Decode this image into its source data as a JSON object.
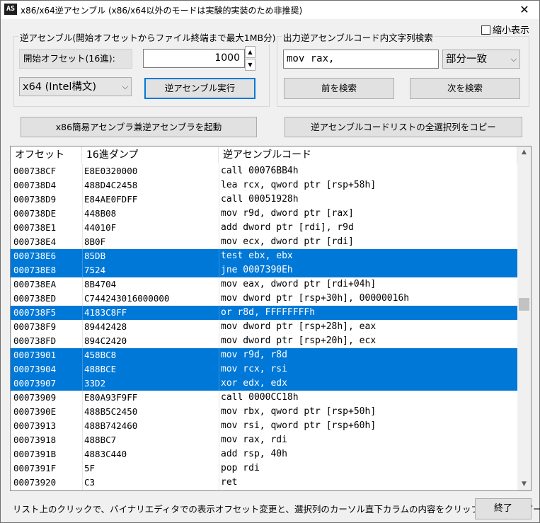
{
  "window": {
    "title": "x86/x64逆アセンブル (x86/x64以外のモードは実験的実装のため非推奨)",
    "icon_text": "AS",
    "close_glyph": "✕"
  },
  "options": {
    "shrink_label": "縮小表示",
    "shrink_checked": false
  },
  "disasm_group": {
    "legend": "逆アセンブル(開始オフセットからファイル終端まで最大1MB分)",
    "offset_label": "開始オフセット(16進):",
    "offset_value": "1000",
    "spin_up": "▲",
    "spin_down": "▼",
    "mode_value": "x64 (Intel構文)",
    "run_button": "逆アセンブル実行"
  },
  "search_group": {
    "legend": "出力逆アセンブルコード内文字列検索",
    "query": "mov rax,",
    "match_mode": "部分一致",
    "prev_button": "前を検索",
    "next_button": "次を検索"
  },
  "actions": {
    "launch_assembler": "x86簡易アセンブラ兼逆アセンブラを起動",
    "copy_column": "逆アセンブルコードリストの全選択列をコピー"
  },
  "list": {
    "columns": [
      "オフセット",
      "16進ダンプ",
      "逆アセンブルコード"
    ],
    "rows": [
      {
        "offset": "000738CF",
        "hex": "E8E0320000",
        "code": "call 00076BB4h",
        "selected": false
      },
      {
        "offset": "000738D4",
        "hex": "488D4C2458",
        "code": "lea rcx, qword ptr [rsp+58h]",
        "selected": false
      },
      {
        "offset": "000738D9",
        "hex": "E84AE0FDFF",
        "code": "call 00051928h",
        "selected": false
      },
      {
        "offset": "000738DE",
        "hex": "448B08",
        "code": "mov r9d, dword ptr [rax]",
        "selected": false
      },
      {
        "offset": "000738E1",
        "hex": "44010F",
        "code": "add dword ptr [rdi], r9d",
        "selected": false
      },
      {
        "offset": "000738E4",
        "hex": "8B0F",
        "code": "mov ecx, dword ptr [rdi]",
        "selected": false
      },
      {
        "offset": "000738E6",
        "hex": "85DB",
        "code": "test ebx, ebx",
        "selected": true
      },
      {
        "offset": "000738E8",
        "hex": "7524",
        "code": "jne 0007390Eh",
        "selected": true
      },
      {
        "offset": "000738EA",
        "hex": "8B4704",
        "code": "mov eax, dword ptr [rdi+04h]",
        "selected": false
      },
      {
        "offset": "000738ED",
        "hex": "C744243016000000",
        "code": "mov dword ptr [rsp+30h], 00000016h",
        "selected": false
      },
      {
        "offset": "000738F5",
        "hex": "4183C8FF",
        "code": "or r8d, FFFFFFFFh",
        "selected": true
      },
      {
        "offset": "000738F9",
        "hex": "89442428",
        "code": "mov dword ptr [rsp+28h], eax",
        "selected": false
      },
      {
        "offset": "000738FD",
        "hex": "894C2420",
        "code": "mov dword ptr [rsp+20h], ecx",
        "selected": false
      },
      {
        "offset": "00073901",
        "hex": "458BC8",
        "code": "mov r9d, r8d",
        "selected": true
      },
      {
        "offset": "00073904",
        "hex": "488BCE",
        "code": "mov rcx, rsi",
        "selected": true
      },
      {
        "offset": "00073907",
        "hex": "33D2",
        "code": "xor edx, edx",
        "selected": true
      },
      {
        "offset": "00073909",
        "hex": "E80A93F9FF",
        "code": "call 0000CC18h",
        "selected": false
      },
      {
        "offset": "0007390E",
        "hex": "488B5C2450",
        "code": "mov rbx, qword ptr [rsp+50h]",
        "selected": false
      },
      {
        "offset": "00073913",
        "hex": "488B742460",
        "code": "mov rsi, qword ptr [rsp+60h]",
        "selected": false
      },
      {
        "offset": "00073918",
        "hex": "488BC7",
        "code": "mov rax, rdi",
        "selected": false
      },
      {
        "offset": "0007391B",
        "hex": "4883C440",
        "code": "add rsp, 40h",
        "selected": false
      },
      {
        "offset": "0007391F",
        "hex": "5F",
        "code": "pop rdi",
        "selected": false
      },
      {
        "offset": "00073920",
        "hex": "C3",
        "code": "ret",
        "selected": false
      }
    ]
  },
  "scrollbar": {
    "up_glyph": "▲",
    "down_glyph": "▼"
  },
  "footer": {
    "status_text": "リスト上のクリックで、バイナリエディタでの表示オフセット変更と、選択列のカーソル直下カラムの内容をクリップボードにコピー",
    "exit_button": "終了"
  },
  "colors": {
    "selection": "#0078d7",
    "focus_border": "#0078d7"
  }
}
